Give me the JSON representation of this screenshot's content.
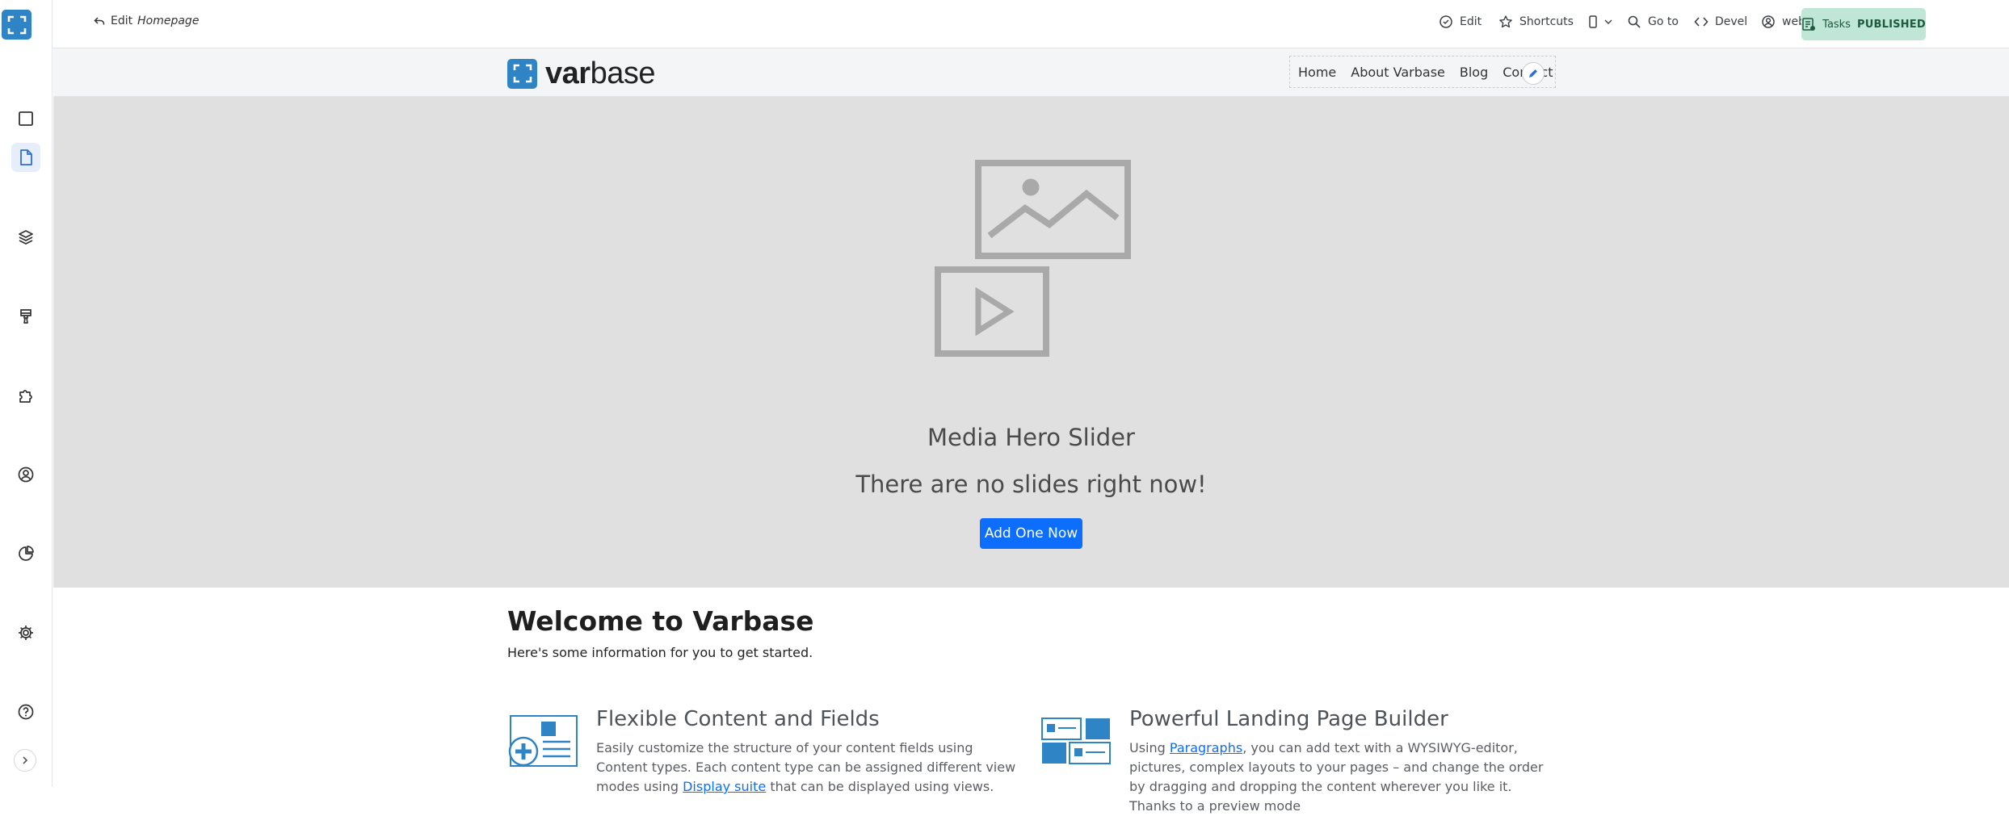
{
  "toolbar": {
    "back_prefix": "Edit",
    "back_page": "Homepage",
    "edit": "Edit",
    "shortcuts": "Shortcuts",
    "goto": "Go to",
    "devel": "Devel",
    "user": "webmaster",
    "tasks": "Tasks",
    "status": "PUBLISHED"
  },
  "sidebar": {
    "icons": [
      "content-icon",
      "document-icon",
      "layers-icon",
      "brush-icon",
      "puzzle-icon",
      "user-icon",
      "reports-icon",
      "gear-icon",
      "help-icon"
    ],
    "active_icon": "document-icon",
    "expand": "chevron-right-icon"
  },
  "site": {
    "logo_bold": "var",
    "logo_rest": "base",
    "nav": [
      "Home",
      "About Varbase",
      "Blog",
      "Contact"
    ]
  },
  "hero": {
    "title": "Media Hero Slider",
    "subtitle": "There are no slides right now!",
    "button": "Add One Now"
  },
  "welcome": {
    "title": "Welcome to Varbase",
    "subtitle": "Here's some information for you to get started."
  },
  "features": [
    {
      "title": "Flexible Content and Fields",
      "text_1": "Easily customize the structure of your content fields using Content types. Each content type can be assigned different view modes using",
      "link": "Display suite",
      "text_2": "that can be displayed using views."
    },
    {
      "title": "Powerful Landing Page Builder",
      "text_1": "Using",
      "link": "Paragraphs",
      "text_2": ", you can add text with a WYSIWYG-editor, pictures, complex layouts to your pages – and change the order by dragging and dropping the content wherever you like it. Thanks to a preview mode"
    }
  ],
  "colors": {
    "brand": "#2f84c6",
    "primary_button": "#0d6efd",
    "tasks_bg": "#bfe6d6",
    "hero_bg": "#e0e0e0"
  }
}
